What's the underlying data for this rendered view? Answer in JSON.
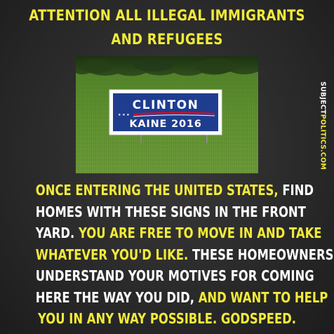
{
  "headline": {
    "line1": "ATTENTION ALL ILLEGAL IMMIGRANTS",
    "line2": "AND REFUGEES"
  },
  "photo": {
    "sign": {
      "top_text": "CLINTON",
      "bottom_text": "KAINE 2016"
    }
  },
  "side_credit": {
    "pre": "SUBJECT",
    "post": "POLITICS.COM"
  },
  "body": {
    "line1": {
      "yellow": "ONCE ENTERING THE UNITED STATES,",
      "white": " FIND"
    },
    "line2": {
      "white": "HOMES WITH THESE SIGNS IN THE FRONT"
    },
    "line3": {
      "white": "YARD. ",
      "yellow": "YOU ARE FREE TO MOVE IN AND TAKE"
    },
    "line4": {
      "yellow": "WHATEVER YOU'D LIKE.",
      "white": " THESE HOMEOWNERS"
    },
    "line5": {
      "white": "UNDERSTAND YOUR MOTIVES FOR COMING"
    },
    "line6": {
      "white": "HERE THE WAY YOU DID, ",
      "yellow": "AND WANT TO HELP"
    },
    "line7": {
      "yellow": "YOU IN ANY WAY POSSIBLE. GODSPEED."
    }
  },
  "colors": {
    "background": "#2a2a2a",
    "accent_yellow": "#f2ea3a",
    "text_white": "#ffffff",
    "sign_blue": "#1f3d8f",
    "sign_red": "#c8102e",
    "grass": "#5a8a2a"
  }
}
